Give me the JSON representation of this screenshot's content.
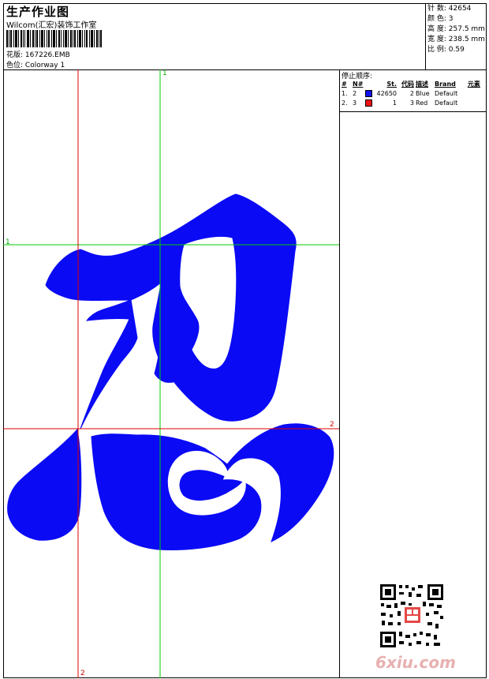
{
  "header": {
    "title": "生产作业图",
    "company": "Wilcom(汇宏)装饰工作室",
    "design_label": "花版:",
    "design_value": "167226.EMB",
    "colorway_label": "色位:",
    "colorway_value": "Colorway 1"
  },
  "stats": {
    "stitches_label": "针 数:",
    "stitches_value": "42654",
    "colors_label": "颜 色:",
    "colors_value": "3",
    "height_label": "高 度:",
    "height_value": "257.5 mm",
    "width_label": "宽 度:",
    "width_value": "238.5 mm",
    "scale_label": "比 例:",
    "scale_value": "0.59"
  },
  "stop_sequence": {
    "heading": "停止顺序:",
    "columns": [
      "#",
      "N#",
      "St.",
      "代码",
      "描述",
      "Brand",
      "元素"
    ],
    "rows": [
      {
        "idx": "1.",
        "n": "2",
        "color": "#1010f0",
        "st": "42650",
        "code": "2",
        "desc": "Blue",
        "brand": "Default",
        "elem": ""
      },
      {
        "idx": "2.",
        "n": "3",
        "color": "#f01010",
        "st": "1",
        "code": "3",
        "desc": "Red",
        "brand": "Default",
        "elem": ""
      }
    ]
  },
  "guides": {
    "green_v_label": "1",
    "green_h_label": "1",
    "red_h_label": "2",
    "red_v_label": "2"
  },
  "colors": {
    "thread_blue": "#0a0af5",
    "guide_green": "#00cc00",
    "guide_red": "#dd0000"
  },
  "watermark": "6xiu.com"
}
